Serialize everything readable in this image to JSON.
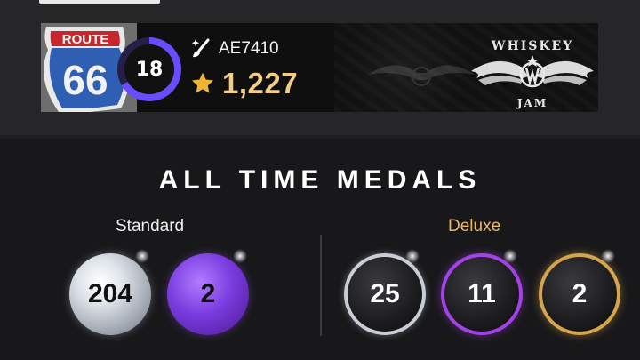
{
  "profile": {
    "level": "18",
    "user_id": "AE7410",
    "score": "1,227",
    "sign_route": "ROUTE",
    "sign_number": "66",
    "banner_brand_top": "WHISKEY",
    "banner_brand_bottom": "JAM",
    "icons": {
      "edit": "paintbrush-sparkle-icon",
      "score": "star-icon"
    },
    "colors": {
      "score": "#f4cd84",
      "level_ring": "#6a4cff"
    }
  },
  "medals": {
    "title": "ALL TIME MEDALS",
    "standard": {
      "label": "Standard",
      "items": [
        {
          "tier": "silver",
          "count": "204"
        },
        {
          "tier": "purple",
          "count": "2"
        }
      ]
    },
    "deluxe": {
      "label": "Deluxe",
      "label_color": "#eab56b",
      "items": [
        {
          "tier": "silver",
          "count": "25"
        },
        {
          "tier": "purple",
          "count": "11"
        },
        {
          "tier": "gold",
          "count": "2"
        }
      ]
    }
  }
}
